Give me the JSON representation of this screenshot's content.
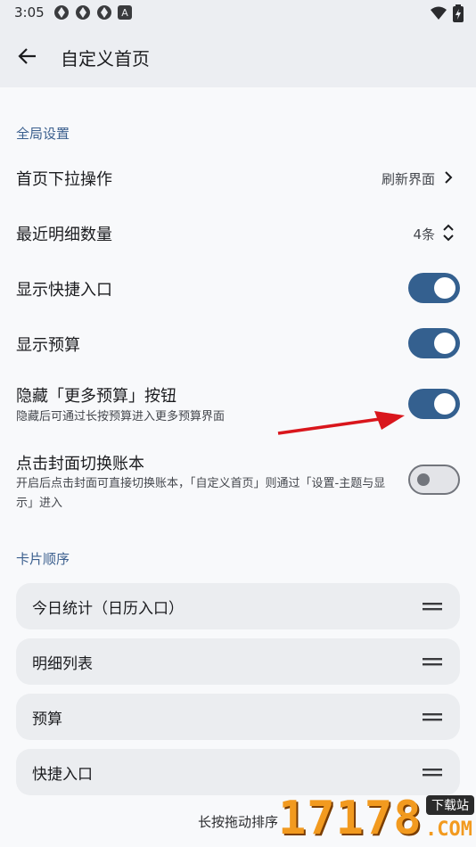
{
  "status_bar": {
    "time": "3:05",
    "badge_letter": "A"
  },
  "app_bar": {
    "title": "自定义首页"
  },
  "global_settings": {
    "section_label": "全局设置",
    "pull_action": {
      "title": "首页下拉操作",
      "value": "刷新界面"
    },
    "recent_count": {
      "title": "最近明细数量",
      "value": "4条"
    },
    "show_shortcuts": {
      "title": "显示快捷入口",
      "enabled": true
    },
    "show_budget": {
      "title": "显示预算",
      "enabled": true
    },
    "hide_more_budget": {
      "title": "隐藏「更多预算」按钮",
      "subtitle": "隐藏后可通过长按预算进入更多预算界面",
      "enabled": true
    },
    "tap_cover_switch": {
      "title": "点击封面切换账本",
      "subtitle": "开启后点击封面可直接切换账本，「自定义首页」则通过「设置-主题与显示」进入",
      "enabled": false
    }
  },
  "card_order": {
    "section_label": "卡片顺序",
    "cards": [
      {
        "label": "今日统计（日历入口）"
      },
      {
        "label": "明细列表"
      },
      {
        "label": "预算"
      },
      {
        "label": "快捷入口"
      }
    ],
    "hint": "长按拖动排序"
  },
  "watermark": {
    "digits": "17178",
    "badge": "下载站",
    "suffix": ".COM"
  },
  "colors": {
    "accent": "#34608f",
    "section": "#3b5f8e",
    "annotation_arrow": "#d9161c"
  }
}
